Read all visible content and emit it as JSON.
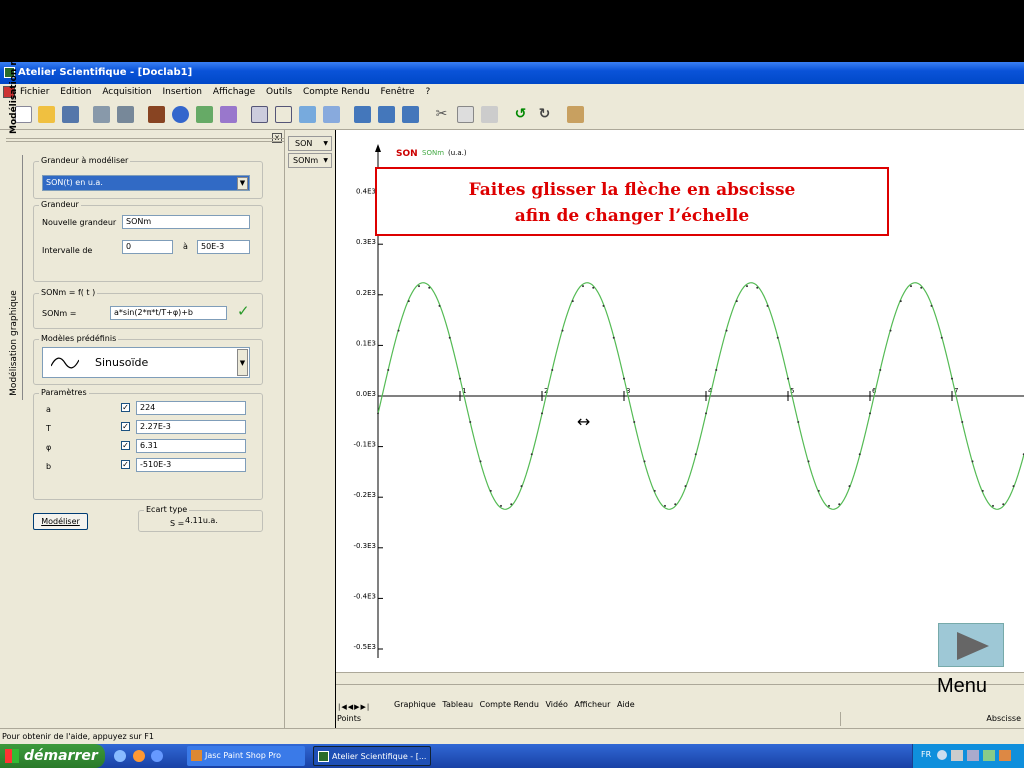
{
  "window": {
    "title": "Atelier Scientifique - [Doclab1]"
  },
  "menu": [
    "Fichier",
    "Edition",
    "Acquisition",
    "Insertion",
    "Affichage",
    "Outils",
    "Compte Rendu",
    "Fenêtre",
    "?"
  ],
  "left_panel": {
    "vertical_tabs": [
      "Modélisation mathématique",
      "Modélisation graphique"
    ],
    "grandeur_a_modeliser": {
      "label": "Grandeur à modéliser",
      "value": "SON(t) en u.a."
    },
    "grandeur": {
      "label": "Grandeur",
      "nouvelle_label": "Nouvelle grandeur",
      "nouvelle_value": "SONm",
      "intervalle_label": "Intervalle de",
      "from": "0",
      "a_label": "à",
      "to": "50E-3"
    },
    "formule": {
      "label": "SONm = f( t )",
      "lhs": "SONm =",
      "expr": "a*sin(2*π*t/T+φ)+b"
    },
    "modeles": {
      "label": "Modèles prédéfinis",
      "value": "Sinusoïde"
    },
    "parametres": {
      "label": "Paramètres",
      "items": [
        {
          "name": "a",
          "value": "224"
        },
        {
          "name": "T",
          "value": "2.27E-3"
        },
        {
          "name": "φ",
          "value": "6.31"
        },
        {
          "name": "b",
          "value": "-510E-3"
        }
      ]
    },
    "modeliser_button": "Modéliser",
    "ecart": {
      "label": "Ecart type",
      "s_label": "S =",
      "value": "4.11u.a."
    }
  },
  "curve_tabs": [
    "SON",
    "SONm"
  ],
  "chart_data": {
    "type": "line",
    "legend_son": "SON",
    "legend_sonm": "SONm",
    "unit": "(u.a.)",
    "ylim": [
      -0.5,
      0.5
    ],
    "y_tick_labels": [
      "0.4E3",
      "0.3E3",
      "0.2E3",
      "0.1E3",
      "0.0E3",
      "-0.1E3",
      "-0.2E3",
      "-0.3E3",
      "-0.4E3",
      "-0.5E3"
    ],
    "x_tick_labels": [
      "1",
      "2",
      "3",
      "4",
      "5",
      "6",
      "7"
    ],
    "series": [
      {
        "name": "SONm",
        "amplitude": 0.224,
        "period": 2.0,
        "phase": 6.31,
        "offset": -0.0005,
        "color": "#55bb55"
      },
      {
        "name": "SON",
        "amplitude": 0.22,
        "period": 2.0,
        "phase": 6.31,
        "color": "#333333"
      }
    ]
  },
  "message": {
    "line1": "Faites glisser la flèche en abscisse",
    "line2": "afin de changer l’échelle"
  },
  "bottom_tabs": [
    "Graphique",
    "Tableau",
    "Compte Rendu",
    "Vidéo",
    "Afficheur",
    "Aide"
  ],
  "bottom_status": {
    "left": "Points",
    "right": "Abscisse"
  },
  "app_status": "Pour obtenir de l'aide, appuyez sur F1",
  "taskbar": {
    "start": "démarrer",
    "tasks": [
      "Jasc Paint Shop Pro",
      "Atelier Scientifique - [..."
    ],
    "lang": "FR"
  },
  "nav": {
    "menu": "Menu"
  }
}
